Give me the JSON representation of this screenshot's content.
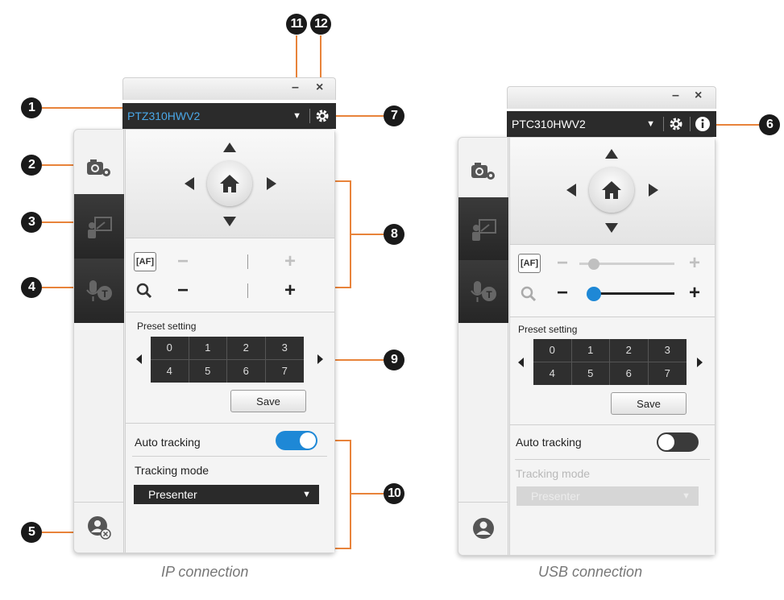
{
  "callouts": {
    "c1": "1",
    "c2": "2",
    "c3": "3",
    "c4": "4",
    "c5": "5",
    "c6": "6",
    "c7": "7",
    "c8": "8",
    "c9": "9",
    "c10": "10",
    "c11": "11",
    "c12": "12"
  },
  "colors": {
    "callout_line": "#e8833a",
    "accent_blue": "#1e88d6",
    "dark_bar": "#2b2b2b"
  },
  "ip": {
    "caption": "IP connection",
    "window_controls": {
      "minimize": "–",
      "close": "×"
    },
    "camera_name": "PTZ310HWV2",
    "preset_title": "Preset setting",
    "presets": [
      "0",
      "1",
      "2",
      "3",
      "4",
      "5",
      "6",
      "7"
    ],
    "save_label": "Save",
    "auto_tracking_label": "Auto tracking",
    "auto_tracking_on": true,
    "tracking_mode_label": "Tracking mode",
    "tracking_mode_value": "Presenter",
    "icons": [
      "camera-settings-icon",
      "presenter-board-icon",
      "voice-tracking-icon",
      "user-remove-icon",
      "gear-icon",
      "home-icon",
      "af-icon",
      "zoom-magnifier-icon"
    ]
  },
  "usb": {
    "caption": "USB connection",
    "window_controls": {
      "minimize": "–",
      "close": "×"
    },
    "camera_name": "PTC310HWV2",
    "preset_title": "Preset setting",
    "presets": [
      "0",
      "1",
      "2",
      "3",
      "4",
      "5",
      "6",
      "7"
    ],
    "save_label": "Save",
    "auto_tracking_label": "Auto tracking",
    "auto_tracking_on": false,
    "tracking_mode_label": "Tracking mode",
    "tracking_mode_value": "Presenter",
    "focus_slider_level": 0.15,
    "zoom_slider_level": 0.05,
    "icons": [
      "camera-settings-icon",
      "presenter-board-icon",
      "voice-tracking-icon",
      "user-icon",
      "gear-icon",
      "info-icon",
      "home-icon",
      "af-icon",
      "zoom-magnifier-icon"
    ]
  }
}
